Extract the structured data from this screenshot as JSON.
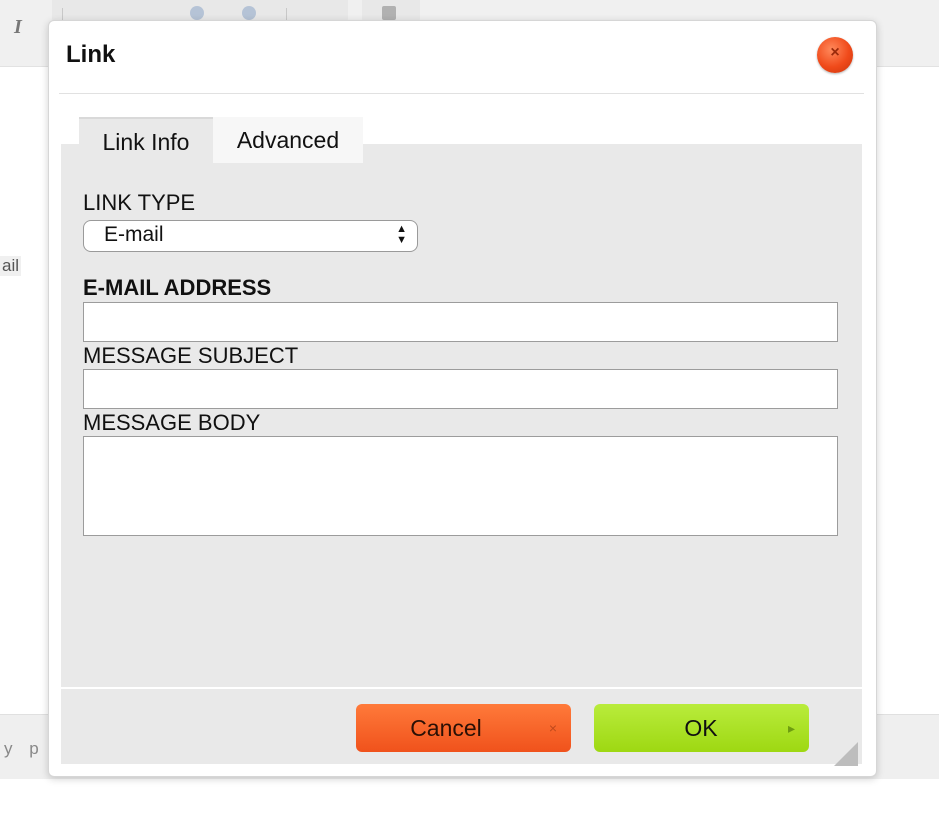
{
  "background": {
    "italic_glyph": "I",
    "partial_text": "ail",
    "status_text": "y p"
  },
  "dialog": {
    "title": "Link",
    "close_glyph": "×",
    "tabs": [
      {
        "label": "Link Info",
        "active": true
      },
      {
        "label": "Advanced",
        "active": false
      }
    ],
    "link_type": {
      "label": "LINK TYPE",
      "selected": "E-mail",
      "arrows": "▲▼"
    },
    "email_address": {
      "label": "E-MAIL ADDRESS",
      "value": "",
      "placeholder": ""
    },
    "message_subject": {
      "label": "MESSAGE SUBJECT",
      "value": "",
      "placeholder": ""
    },
    "message_body": {
      "label": "MESSAGE BODY",
      "value": "",
      "placeholder": ""
    },
    "buttons": {
      "cancel": {
        "label": "Cancel",
        "icon": "×"
      },
      "ok": {
        "label": "OK",
        "icon": "▸"
      }
    }
  },
  "colors": {
    "cancel": "#f0521c",
    "ok": "#9ed812",
    "close": "#f04a1a",
    "panel": "#e9e9e9"
  }
}
